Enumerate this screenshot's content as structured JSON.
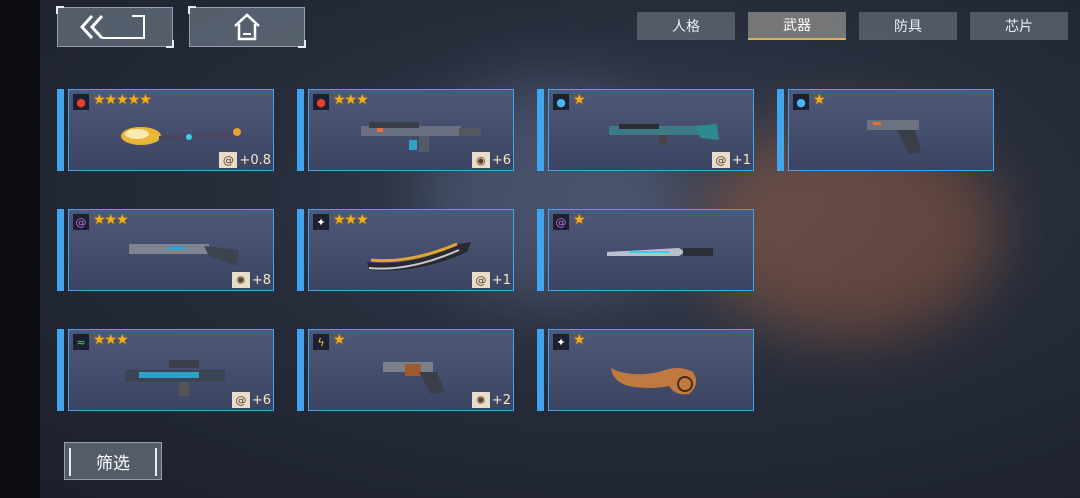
{
  "nav": {
    "back_icon": "back-arrow-icon",
    "home_icon": "home-icon"
  },
  "tabs": [
    {
      "label": "人格",
      "active": false
    },
    {
      "label": "武器",
      "active": true
    },
    {
      "label": "防具",
      "active": false
    },
    {
      "label": "芯片",
      "active": false
    }
  ],
  "weapons": [
    {
      "element": "fire",
      "stars": "★★★★★",
      "bonus": "+0.8",
      "badge_icon": "swirl-icon"
    },
    {
      "element": "fire",
      "stars": "★★★",
      "bonus": "+6",
      "badge_icon": "creature-icon"
    },
    {
      "element": "water",
      "stars": "★",
      "bonus": "+1",
      "badge_icon": "swirl-icon"
    },
    {
      "element": "water",
      "stars": "★",
      "bonus": "",
      "badge_icon": ""
    },
    {
      "element": "psychic",
      "stars": "★★★",
      "bonus": "+8",
      "badge_icon": "gear-icon"
    },
    {
      "element": "light",
      "stars": "★★★",
      "bonus": "+1",
      "badge_icon": "swirl-icon"
    },
    {
      "element": "psychic",
      "stars": "★",
      "bonus": "",
      "badge_icon": ""
    },
    {
      "element": "wind",
      "stars": "★★★",
      "bonus": "+6",
      "badge_icon": "swirl-icon"
    },
    {
      "element": "electric",
      "stars": "★",
      "bonus": "+2",
      "badge_icon": "gear-icon"
    },
    {
      "element": "light",
      "stars": "★",
      "bonus": "",
      "badge_icon": ""
    }
  ],
  "filter": {
    "label": "筛选"
  },
  "colors": {
    "card_border": "#3fa6ee",
    "star": "#f2b01e",
    "active_tab_underline": "#e0b34a"
  }
}
